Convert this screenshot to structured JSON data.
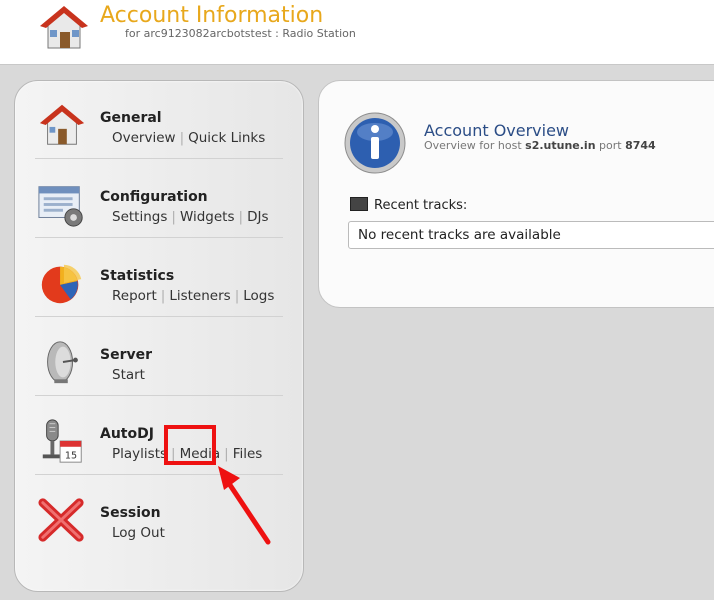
{
  "header": {
    "title": "Account Information",
    "subtitle": "for arc9123082arcbotstest : Radio Station",
    "icon": "house-icon"
  },
  "sidebar": {
    "sections": [
      {
        "title": "General",
        "icon": "house-icon",
        "links": [
          "Overview",
          "Quick Links"
        ]
      },
      {
        "title": "Configuration",
        "icon": "settings-window-icon",
        "links": [
          "Settings",
          "Widgets",
          "DJs"
        ]
      },
      {
        "title": "Statistics",
        "icon": "pie-chart-icon",
        "links": [
          "Report",
          "Listeners",
          "Logs"
        ]
      },
      {
        "title": "Server",
        "icon": "satellite-dish-icon",
        "links": [
          "Start"
        ]
      },
      {
        "title": "AutoDJ",
        "icon": "microphone-calendar-icon",
        "links": [
          "Playlists",
          "Media",
          "Files"
        ]
      },
      {
        "title": "Session",
        "icon": "red-x-icon",
        "links": [
          "Log Out"
        ]
      }
    ]
  },
  "main": {
    "overview_title": "Account Overview",
    "overview_sub_prefix": "Overview for host",
    "host": "s2.utune.in",
    "port_label": "port",
    "port": "8744",
    "recent_tracks_label": "Recent tracks:",
    "recent_tracks_text": "No recent tracks are available"
  },
  "colors": {
    "header_title": "#e8a81c",
    "overview_title": "#2b4d86",
    "highlight": "#ee1111"
  }
}
